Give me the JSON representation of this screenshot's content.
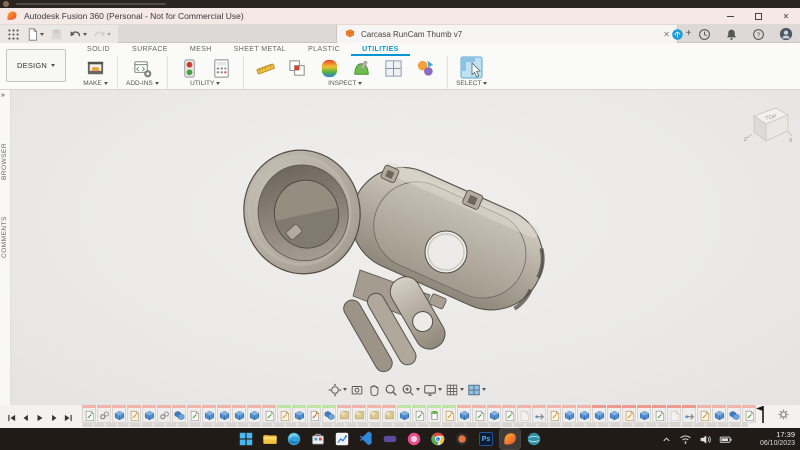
{
  "titlebar": {
    "title": "Autodesk Fusion 360 (Personal - Not for Commercial Use)"
  },
  "window_controls": {
    "close_glyph": "✕"
  },
  "quick_access": {
    "icons": [
      {
        "name": "app-grid-icon"
      },
      {
        "name": "file-icon",
        "caret": true
      },
      {
        "name": "save-icon",
        "disabled": true
      },
      {
        "name": "undo-icon",
        "caret": true
      },
      {
        "name": "redo-icon",
        "caret": true,
        "disabled": true
      }
    ]
  },
  "document_tabs": {
    "active_tab": {
      "label": "Carcasa RunCam Thumb v7",
      "icon": "doc-cube-icon"
    },
    "close_glyph": "✕",
    "new_tab_glyph": "+"
  },
  "header_icons": [
    {
      "name": "extensions-icon"
    },
    {
      "name": "job-status-icon"
    },
    {
      "name": "notifications-icon"
    },
    {
      "name": "help-icon"
    },
    {
      "name": "profile-avatar"
    }
  ],
  "ribbon": {
    "design_button": {
      "label": "DESIGN"
    },
    "tabs": [
      {
        "label": "SOLID"
      },
      {
        "label": "SURFACE"
      },
      {
        "label": "MESH"
      },
      {
        "label": "SHEET METAL"
      },
      {
        "label": "PLASTIC"
      },
      {
        "label": "UTILITIES",
        "active": true
      }
    ],
    "groups": [
      {
        "label": "MAKE",
        "caret": true,
        "icons": [
          "make-3dprint-icon"
        ]
      },
      {
        "label": "ADD-INS",
        "caret": true,
        "icons": [
          "addins-scripts-icon"
        ]
      },
      {
        "label": "UTILITY",
        "caret": true,
        "icons": [
          "utility-trafficlight-icon",
          "utility-calculator-icon"
        ]
      },
      {
        "label": "INSPECT",
        "caret": true,
        "icons": [
          "measure-icon",
          "interference-icon",
          "curvature-icon",
          "draft-analysis-icon",
          "section-analysis-icon",
          "component-color-icon"
        ]
      },
      {
        "label": "SELECT",
        "caret": true,
        "large": true,
        "icons": [
          "select-icon"
        ]
      }
    ]
  },
  "left_rail": {
    "expand_glyph": "»",
    "panels": [
      {
        "label": "BROWSER"
      },
      {
        "label": "COMMENTS"
      }
    ]
  },
  "viewcube": {
    "top_label": "TOP",
    "axis_labels": [
      "Z",
      "X"
    ]
  },
  "nav_toolbar": {
    "icons": [
      {
        "name": "orbit-icon",
        "caret": true
      },
      {
        "name": "look-at-icon"
      },
      {
        "name": "pan-icon"
      },
      {
        "name": "zoom-icon"
      },
      {
        "name": "fit-icon",
        "caret": true
      },
      {
        "name": "display-settings-icon",
        "caret": true
      },
      {
        "name": "grid-settings-icon",
        "caret": true
      },
      {
        "name": "viewports-icon",
        "caret": true
      }
    ]
  },
  "timeline": {
    "playback": [
      "skip-start-icon",
      "step-back-icon",
      "play-icon",
      "step-forward-icon",
      "skip-end-icon"
    ],
    "features": [
      "sketch",
      "joint",
      "extrude",
      "sketch-edit",
      "extrude",
      "joint",
      "extrude2",
      "sketch",
      "extrude",
      "extrude",
      "extrude",
      "extrude",
      "sketch",
      "sketch-edit",
      "extrude",
      "sketch-orange",
      "extrude2",
      "fillet",
      "fillet",
      "fillet",
      "fillet",
      "extrude",
      "sketch",
      "hole",
      "sketch-edit",
      "extrude",
      "sketch",
      "extrude",
      "sketch",
      "sketch-ghost",
      "move",
      "sketch-edit",
      "extrude",
      "extrude",
      "extrude",
      "extrude",
      "sketch-edit",
      "extrude",
      "sketch",
      "sketch-ghost",
      "move",
      "sketch-edit",
      "extrude",
      "extrude2",
      "sketch"
    ],
    "group_bars": [
      {
        "from": 0,
        "to": 12,
        "color": "#f1b4ab"
      },
      {
        "from": 13,
        "to": 16,
        "color": "#bfe3a4"
      },
      {
        "from": 17,
        "to": 20,
        "color": "#f1b4ab"
      },
      {
        "from": 21,
        "to": 24,
        "color": "#bfe3a4"
      },
      {
        "from": 25,
        "to": 33,
        "color": "#f1b4ab"
      },
      {
        "from": 34,
        "to": 40,
        "color": "#ec9a90"
      },
      {
        "from": 41,
        "to": 44,
        "color": "#f1b4ab"
      }
    ]
  },
  "taskbar": {
    "apps": [
      {
        "name": "start-icon"
      },
      {
        "name": "file-explorer-icon"
      },
      {
        "name": "edge-icon"
      },
      {
        "name": "store-icon"
      },
      {
        "name": "stats-app-icon"
      },
      {
        "name": "vscode-icon"
      },
      {
        "name": "purple-app-icon"
      },
      {
        "name": "media-app-icon"
      },
      {
        "name": "chrome-icon"
      },
      {
        "name": "round-app-icon"
      },
      {
        "name": "photoshop-icon",
        "label": "Ps"
      },
      {
        "name": "fusion360-icon",
        "active": true
      },
      {
        "name": "slicer-app-icon"
      }
    ],
    "tray": [
      {
        "name": "tray-chevron-icon"
      },
      {
        "name": "wifi-icon"
      },
      {
        "name": "volume-icon"
      },
      {
        "name": "battery-icon"
      }
    ],
    "clock": {
      "time": "17:39",
      "date": "06/10/2023"
    }
  }
}
